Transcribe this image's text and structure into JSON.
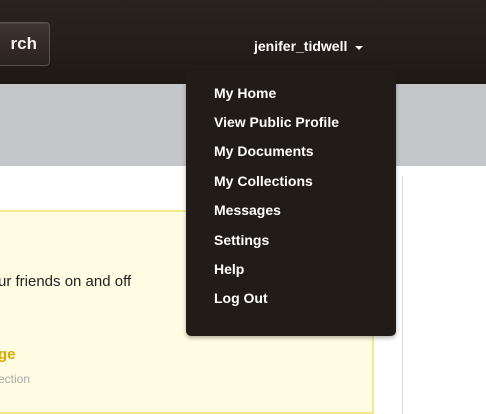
{
  "header": {
    "search_label": "rch",
    "username": "jenifer_tidwell"
  },
  "dropdown": {
    "items": [
      "My Home",
      "View Public Profile",
      "My Documents",
      "My Collections",
      "Messages",
      "Settings",
      "Help",
      "Log Out"
    ]
  },
  "content": {
    "friends_text": "ur friends on and off",
    "manage_label": "ge",
    "collection_text": "ection"
  },
  "colors": {
    "topbar": "#241d19",
    "dropdown_bg": "#221c18",
    "grey_band": "#c4c6c9",
    "yellow_box": "#fefce3",
    "yellow_border": "#f1e98a",
    "link": "#d8a900"
  }
}
